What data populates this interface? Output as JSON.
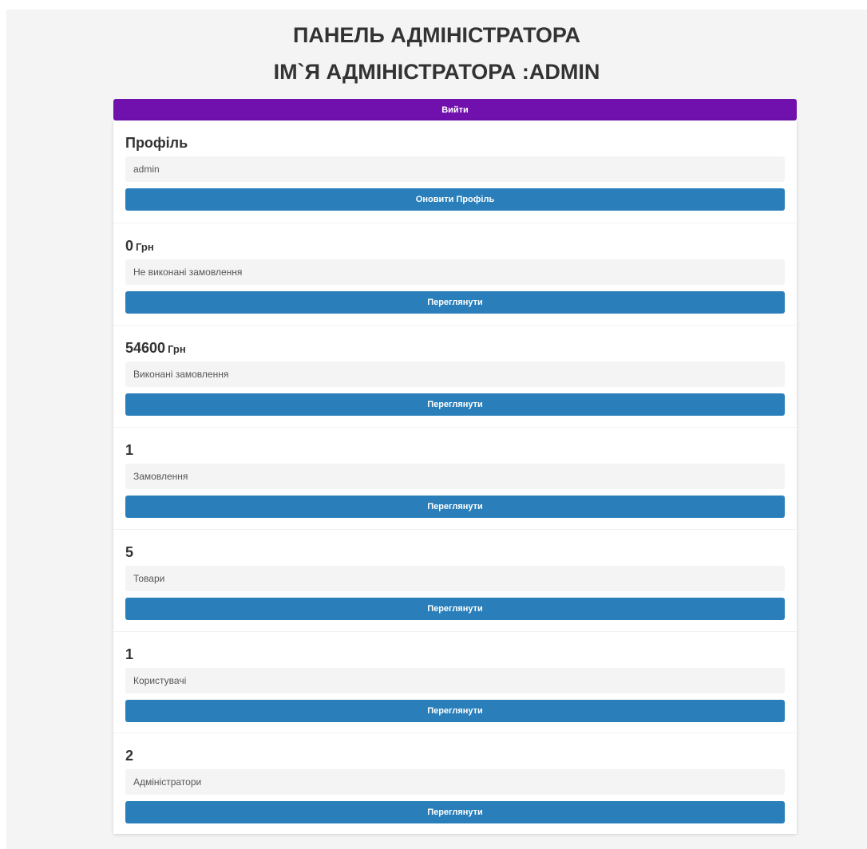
{
  "header": {
    "title": "ПАНЕЛЬ АДМІНІСТРАТОРА",
    "admin_name_line": "ІМ`Я АДМІНІСТРАТОРА :ADMIN"
  },
  "logout_label": "Вийти",
  "profile": {
    "heading": "Профіль",
    "value": "admin",
    "button_label": "Оновити Профіль"
  },
  "boxes": [
    {
      "number": "0",
      "unit": "Грн",
      "label": "Не виконані замовлення",
      "button_label": "Переглянути"
    },
    {
      "number": "54600",
      "unit": "Грн",
      "label": "Виконані замовлення",
      "button_label": "Переглянути"
    },
    {
      "number": "1",
      "unit": "",
      "label": "Замовлення",
      "button_label": "Переглянути"
    },
    {
      "number": "5",
      "unit": "",
      "label": "Товари",
      "button_label": "Переглянути"
    },
    {
      "number": "1",
      "unit": "",
      "label": "Користувачі",
      "button_label": "Переглянути"
    },
    {
      "number": "2",
      "unit": "",
      "label": "Адміністратори",
      "button_label": "Переглянути"
    }
  ],
  "colors": {
    "logout_button": "#7011ad",
    "action_button": "#2a7fba",
    "page_background": "#f4f4f4"
  }
}
